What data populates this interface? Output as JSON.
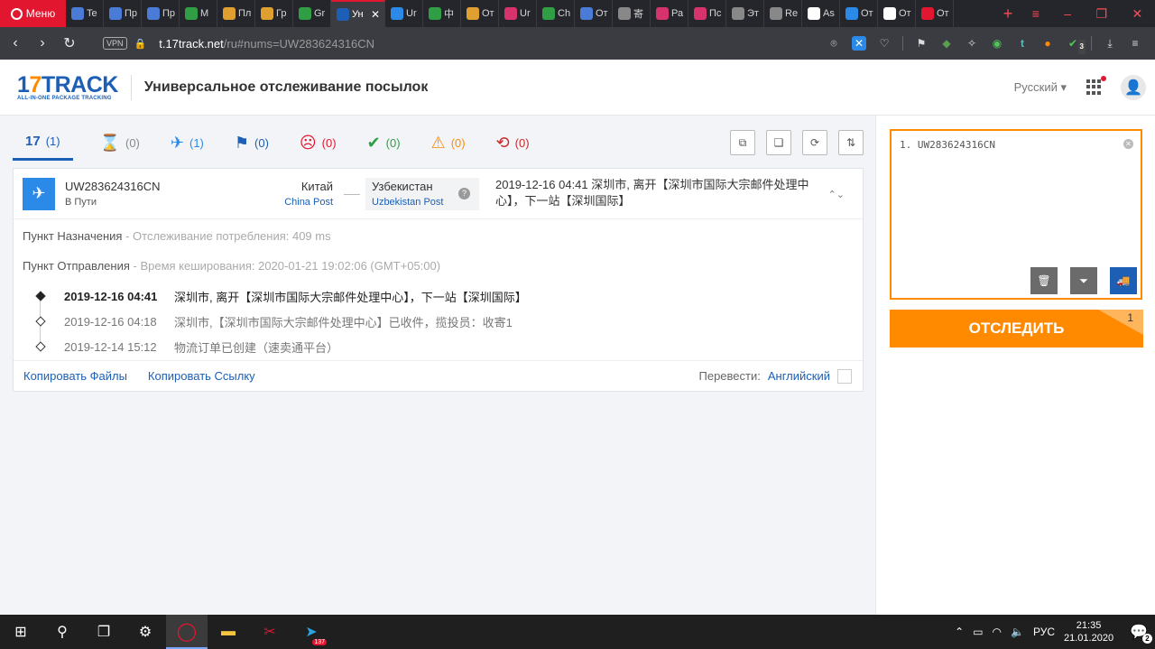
{
  "browser": {
    "menu_label": "Меню",
    "tabs": [
      {
        "label": "Te",
        "color": "#4a7bd6"
      },
      {
        "label": "Пр",
        "color": "#4a7bd6"
      },
      {
        "label": "Пр",
        "color": "#4a7bd6"
      },
      {
        "label": "M",
        "color": "#2f9e44"
      },
      {
        "label": "Пл",
        "color": "#e0a030"
      },
      {
        "label": "Гр",
        "color": "#e0a030"
      },
      {
        "label": "Gr",
        "color": "#2f9e44"
      },
      {
        "label": "Ун",
        "color": "#1c5fb5",
        "active": true
      },
      {
        "label": "Ur",
        "color": "#2b8ae8"
      },
      {
        "label": "中",
        "color": "#2f9e44"
      },
      {
        "label": "От",
        "color": "#e0a030"
      },
      {
        "label": "Ur",
        "color": "#d6336c"
      },
      {
        "label": "Ch",
        "color": "#2f9e44"
      },
      {
        "label": "От",
        "color": "#4a7bd6"
      },
      {
        "label": "寄",
        "color": "#888888"
      },
      {
        "label": "Ра",
        "color": "#d6336c"
      },
      {
        "label": "Пс",
        "color": "#d6336c"
      },
      {
        "label": "Эт",
        "color": "#888888"
      },
      {
        "label": "Re",
        "color": "#888888"
      },
      {
        "label": "As",
        "color": "#ffffff"
      },
      {
        "label": "От",
        "color": "#2b8ae8"
      },
      {
        "label": "От",
        "color": "#ffffff"
      },
      {
        "label": "От",
        "color": "#e3162f"
      }
    ],
    "url_host": "t.17track.net",
    "url_path": "/ru#nums=UW283624316CN",
    "vpn_label": "VPN",
    "ext_badge": "3"
  },
  "header": {
    "logo_text": "17TRACK",
    "logo_tagline": "ALL-IN-ONE PACKAGE TRACKING",
    "title": "Универсальное отслеживание посылок",
    "language": "Русский ▾"
  },
  "filters": [
    {
      "name": "filter-all",
      "icon": "17",
      "count": "(1)",
      "color": "#1c5fb5"
    },
    {
      "name": "filter-not-found",
      "icon": "⌛",
      "count": "(0)",
      "color": "#888888"
    },
    {
      "name": "filter-in-transit",
      "icon": "✈",
      "count": "(1)",
      "color": "#2b8ae8"
    },
    {
      "name": "filter-pickup",
      "icon": "⚑",
      "count": "(0)",
      "color": "#1c5fb5"
    },
    {
      "name": "filter-undelivered",
      "icon": "☹",
      "count": "(0)",
      "color": "#e3162f"
    },
    {
      "name": "filter-delivered",
      "icon": "✔",
      "count": "(0)",
      "color": "#2f9e44"
    },
    {
      "name": "filter-alert",
      "icon": "⚠",
      "count": "(0)",
      "color": "#ff8a00"
    },
    {
      "name": "filter-expired",
      "icon": "⟲",
      "count": "(0)",
      "color": "#c92a2a"
    }
  ],
  "shipment": {
    "number": "UW283624316CN",
    "status": "В Пути",
    "origin_country": "Китай",
    "origin_carrier": "China Post",
    "dest_country": "Узбекистан",
    "dest_carrier": "Uzbekistan Post",
    "latest_event": "2019-12-16 04:41  深圳市, 离开【深圳市国际大宗邮件处理中心】，下一站【深圳国际】",
    "dest_label": "Пункт Назначения",
    "dest_sub": " - Отслеживание потребления: 409 ms",
    "origin_label": "Пункт Отправления",
    "origin_sub": " - Время кеширования: 2020-01-21 19:02:06 (GMT+05:00)",
    "events": [
      {
        "time": "2019-12-16 04:41",
        "desc": "深圳市, 离开【深圳市国际大宗邮件处理中心】，下一站【深圳国际】"
      },
      {
        "time": "2019-12-16 04:18",
        "desc": "深圳市,【深圳市国际大宗邮件处理中心】已收件，揽投员：收寄1"
      },
      {
        "time": "2019-12-14 15:12",
        "desc": "物流订单已创建（速卖通平台）"
      }
    ],
    "copy_files": "Копировать Файлы",
    "copy_link": "Копировать Ссылку",
    "translate_label": "Перевести:",
    "translate_lang": "Английский"
  },
  "panel": {
    "input_text": "1. UW283624316CN",
    "track_button": "ОТСЛЕДИТЬ",
    "track_count": "1"
  },
  "taskbar": {
    "badge": "137",
    "lang": "РУС",
    "time": "21:35",
    "date": "21.01.2020",
    "notif_count": "2"
  }
}
